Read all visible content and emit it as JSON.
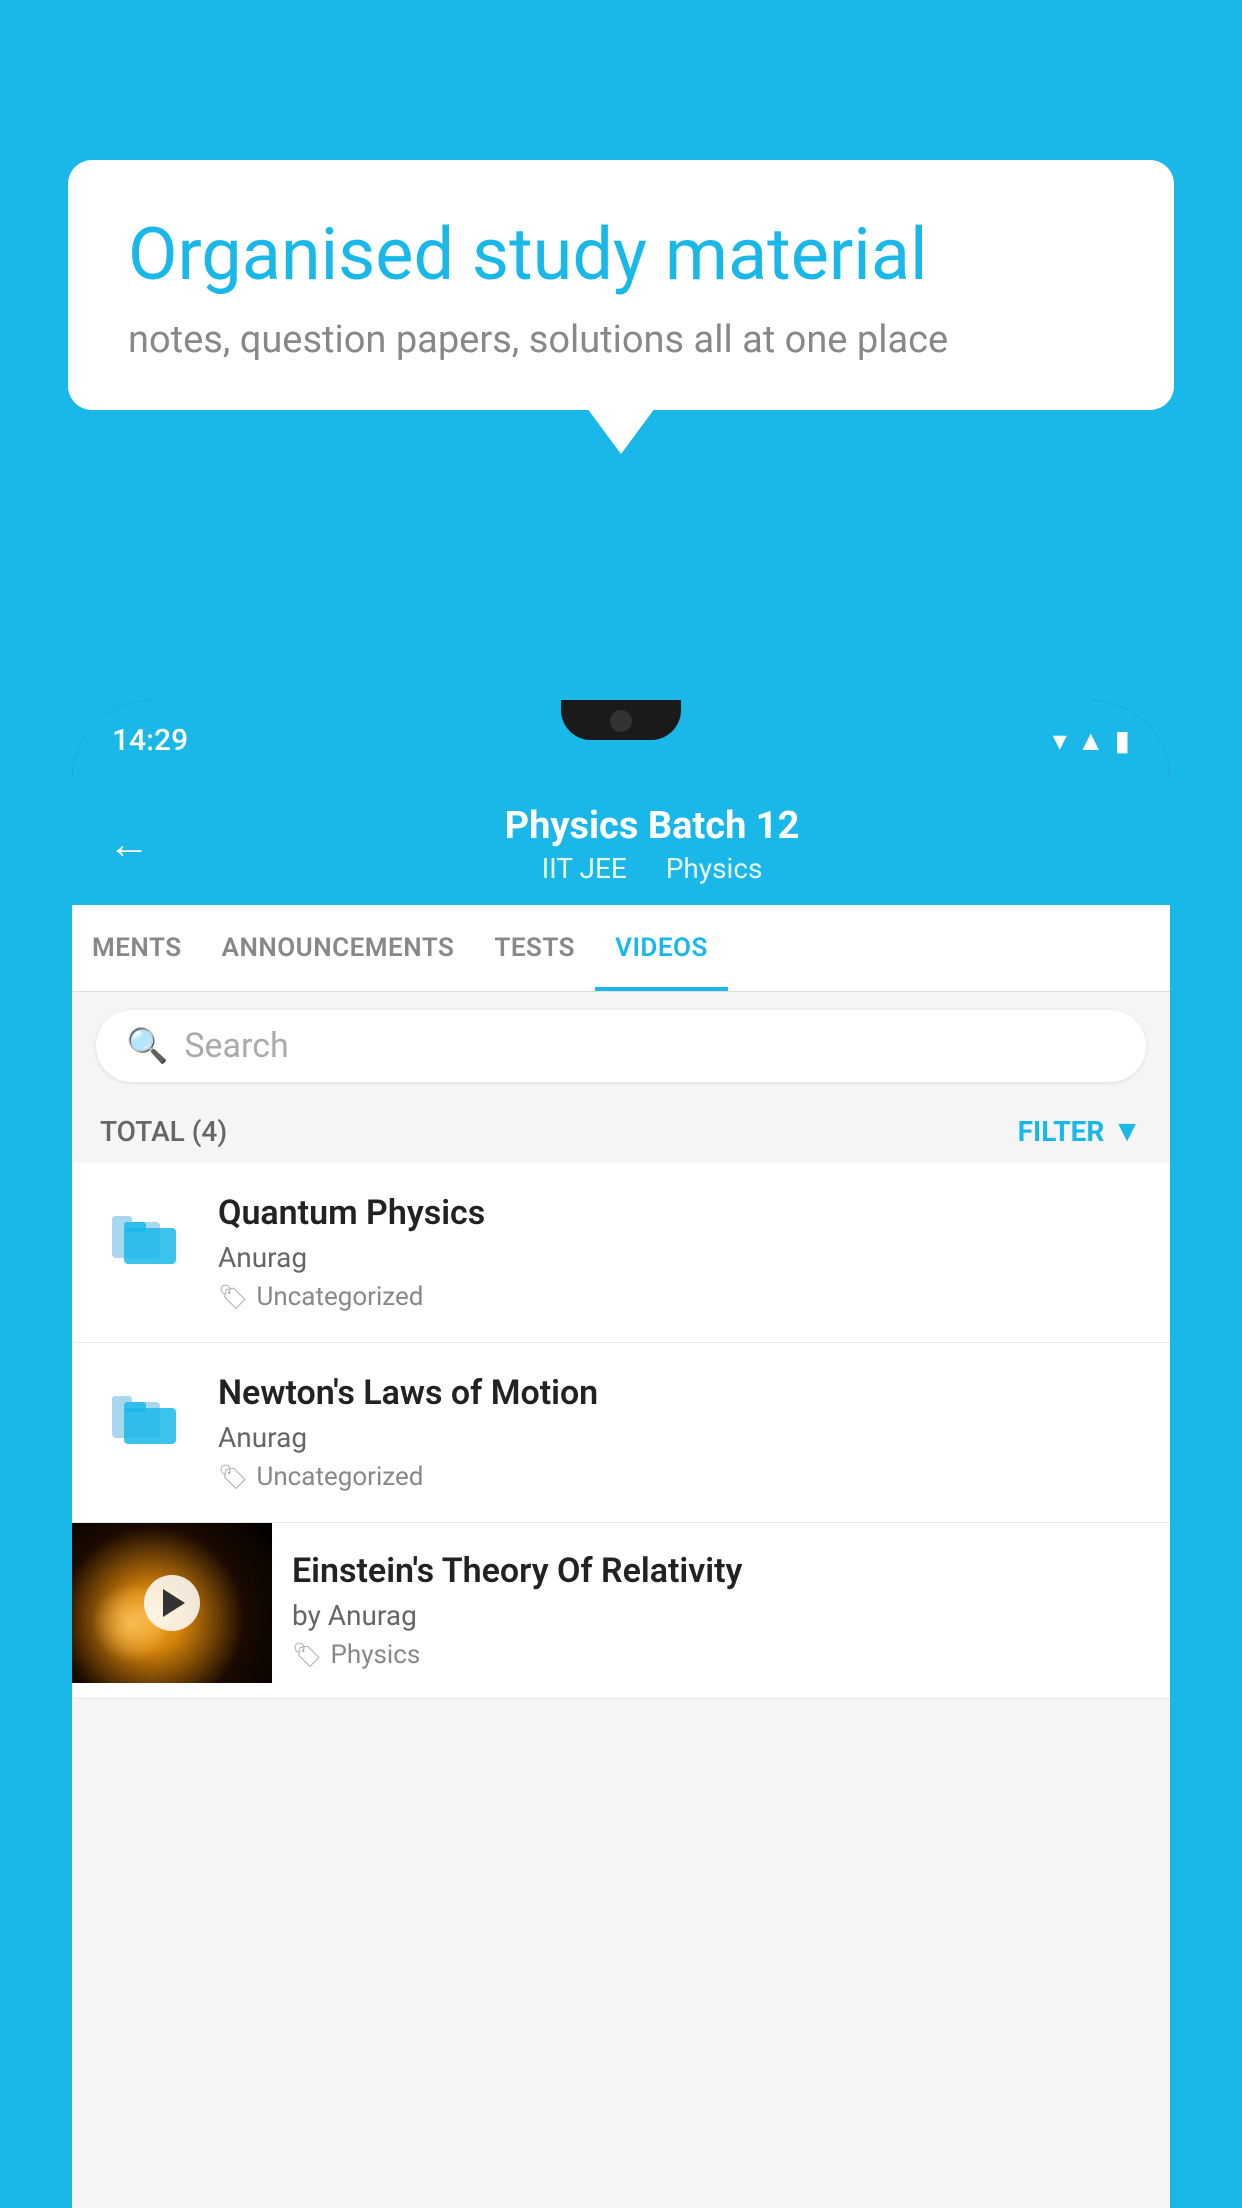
{
  "background_color": "#1ab8e8",
  "speech_bubble": {
    "title": "Organised study material",
    "subtitle": "notes, question papers, solutions all at one place"
  },
  "status_bar": {
    "time": "14:29"
  },
  "app_header": {
    "title": "Physics Batch 12",
    "subtitle_part1": "IIT JEE",
    "subtitle_part2": "Physics"
  },
  "tabs": [
    {
      "label": "MENTS",
      "active": false
    },
    {
      "label": "ANNOUNCEMENTS",
      "active": false
    },
    {
      "label": "TESTS",
      "active": false
    },
    {
      "label": "VIDEOS",
      "active": true
    }
  ],
  "search": {
    "placeholder": "Search"
  },
  "filter_bar": {
    "total_label": "TOTAL (4)",
    "filter_label": "FILTER"
  },
  "videos": [
    {
      "id": "1",
      "title": "Quantum Physics",
      "author": "Anurag",
      "tag": "Uncategorized",
      "has_thumbnail": false
    },
    {
      "id": "2",
      "title": "Newton's Laws of Motion",
      "author": "Anurag",
      "tag": "Uncategorized",
      "has_thumbnail": false
    },
    {
      "id": "3",
      "title": "Einstein's Theory Of Relativity",
      "author": "by Anurag",
      "tag": "Physics",
      "has_thumbnail": true
    }
  ]
}
